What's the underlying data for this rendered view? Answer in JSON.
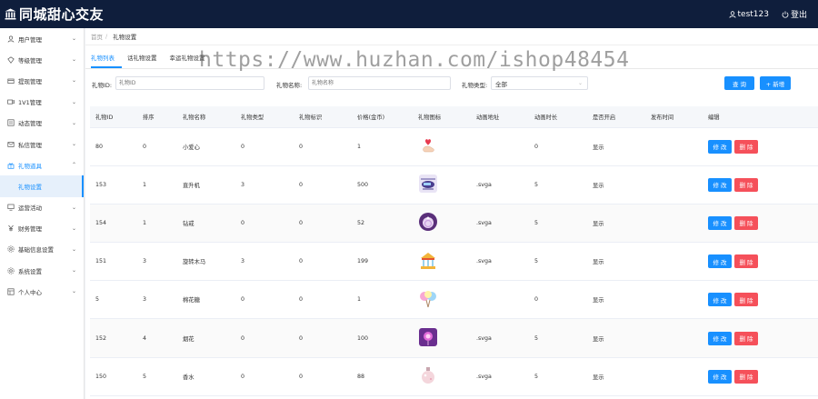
{
  "app": {
    "title": "同城甜心交友",
    "user": "test123",
    "logout": "登出"
  },
  "sidebar": {
    "items": [
      {
        "label": "用户管理",
        "icon": "user-icon"
      },
      {
        "label": "等级管理",
        "icon": "level-icon"
      },
      {
        "label": "提现管理",
        "icon": "withdraw-icon"
      },
      {
        "label": "1V1管理",
        "icon": "video-icon"
      },
      {
        "label": "动态管理",
        "icon": "feed-icon"
      },
      {
        "label": "私信管理",
        "icon": "message-icon"
      },
      {
        "label": "礼物道具",
        "icon": "gift-icon"
      },
      {
        "label": "礼物设置",
        "icon": ""
      },
      {
        "label": "运营活动",
        "icon": "activity-icon"
      },
      {
        "label": "财务管理",
        "icon": "finance-icon"
      },
      {
        "label": "基础信息设置",
        "icon": "settings-icon"
      },
      {
        "label": "系统设置",
        "icon": "system-icon"
      },
      {
        "label": "个人中心",
        "icon": "profile-icon"
      }
    ]
  },
  "breadcrumb": {
    "home": "首页",
    "sep": "/",
    "current": "礼物设置"
  },
  "tabs": [
    "礼物列表",
    "话礼物设置",
    "幸运礼物设置"
  ],
  "watermark": "https://www.huzhan.com/ishop48454",
  "filters": {
    "id_label": "礼物ID:",
    "id_placeholder": "礼物ID",
    "name_label": "礼物名称:",
    "name_placeholder": "礼物名称",
    "type_label": "礼物类型:",
    "type_value": "全部",
    "query_button": "查 询",
    "add_button": "+ 新增"
  },
  "table": {
    "headers": [
      "礼物ID",
      "排序",
      "礼物名称",
      "礼物类型",
      "礼物标识",
      "价格(金币)",
      "礼物图标",
      "动画地址",
      "动画时长",
      "是否开启",
      "发布时间",
      "编辑"
    ],
    "edit_label": "修 改",
    "delete_label": "删 除",
    "rows": [
      {
        "id": "80",
        "sort": "0",
        "name": "小爱心",
        "type": "0",
        "mark": "0",
        "price": "1",
        "icon": "heart-hand-icon",
        "anim": "",
        "duration": "0",
        "enabled": "显示",
        "time": ""
      },
      {
        "id": "153",
        "sort": "1",
        "name": "直升机",
        "type": "3",
        "mark": "0",
        "price": "500",
        "icon": "helicopter-icon",
        "anim": ".svga",
        "duration": "5",
        "enabled": "显示",
        "time": ""
      },
      {
        "id": "154",
        "sort": "1",
        "name": "钻戒",
        "type": "0",
        "mark": "0",
        "price": "52",
        "icon": "ring-icon",
        "anim": ".svga",
        "duration": "5",
        "enabled": "显示",
        "time": ""
      },
      {
        "id": "151",
        "sort": "3",
        "name": "旋转木马",
        "type": "3",
        "mark": "0",
        "price": "199",
        "icon": "carousel-icon",
        "anim": ".svga",
        "duration": "5",
        "enabled": "显示",
        "time": ""
      },
      {
        "id": "5",
        "sort": "3",
        "name": "棉花糖",
        "type": "0",
        "mark": "0",
        "price": "1",
        "icon": "cotton-candy-icon",
        "anim": "",
        "duration": "0",
        "enabled": "显示",
        "time": ""
      },
      {
        "id": "152",
        "sort": "4",
        "name": "烟花",
        "type": "0",
        "mark": "0",
        "price": "100",
        "icon": "fireworks-icon",
        "anim": ".svga",
        "duration": "5",
        "enabled": "显示",
        "time": ""
      },
      {
        "id": "150",
        "sort": "5",
        "name": "香水",
        "type": "0",
        "mark": "0",
        "price": "88",
        "icon": "perfume-icon",
        "anim": ".svga",
        "duration": "5",
        "enabled": "显示",
        "time": ""
      }
    ]
  },
  "colors": {
    "topbar": "#0f1e3c",
    "primary": "#1890ff",
    "danger": "#f5505a"
  }
}
